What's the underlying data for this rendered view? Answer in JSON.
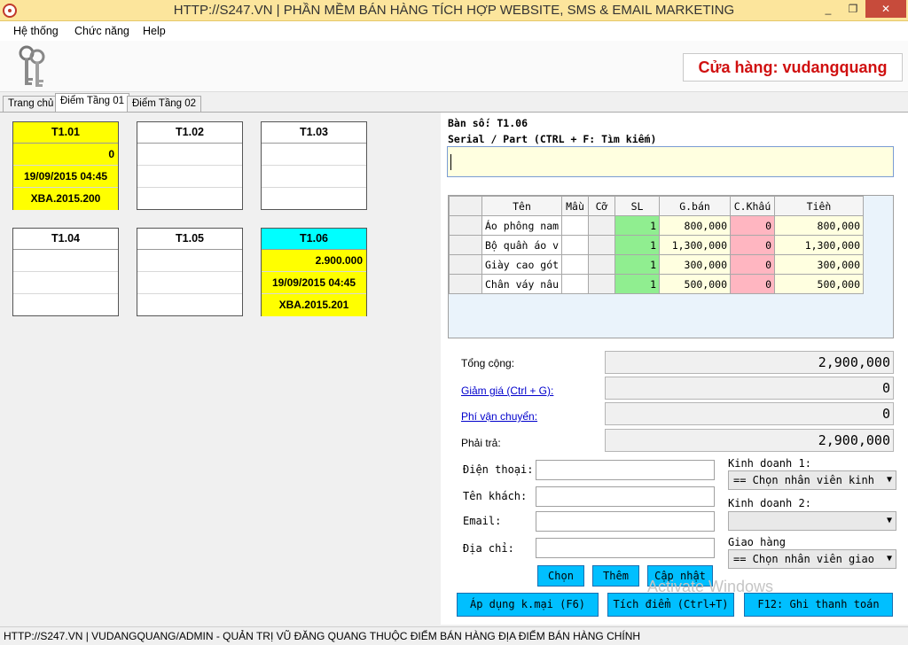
{
  "window": {
    "title": "HTTP://S247.VN | PHẦN MỀM BÁN HÀNG TÍCH HỢP WEBSITE, SMS & EMAIL MARKETING",
    "minimize": "_",
    "restore": "❐",
    "close": "✕"
  },
  "menu": [
    "Hệ thống",
    "Chức năng",
    "Help"
  ],
  "toolbar": {
    "store_label": "Cửa hàng: vudangquang",
    "keys_icon": "keys-icon"
  },
  "tabs": [
    {
      "label": "Trang chủ",
      "active": false
    },
    {
      "label": "Điểm Tầng 01",
      "active": true
    },
    {
      "label": "Điểm Tầng 02",
      "active": false
    }
  ],
  "tables": [
    {
      "name": "T1.01",
      "amount": "0",
      "time": "19/09/2015 04:45",
      "code": "XBA.2015.200"
    },
    {
      "name": "T1.02",
      "amount": "",
      "time": "",
      "code": ""
    },
    {
      "name": "T1.03",
      "amount": "",
      "time": "",
      "code": ""
    },
    {
      "name": "T1.04",
      "amount": "",
      "time": "",
      "code": ""
    },
    {
      "name": "T1.05",
      "amount": "",
      "time": "",
      "code": ""
    },
    {
      "name": "T1.06",
      "amount": "2.900.000",
      "time": "19/09/2015 04:45",
      "code": "XBA.2015.201"
    }
  ],
  "order": {
    "ban_so": "Bàn số: T1.06",
    "serial_label": "Serial / Part (CTRL + F: Tìm kiếm)",
    "serial_value": "",
    "columns": [
      "Tên",
      "Mầu",
      "Cỡ",
      "SL",
      "G.bán",
      "C.Khấu",
      "Tiền"
    ],
    "items": [
      {
        "name": "Áo phông nam",
        "mau": "",
        "co": "",
        "sl": "1",
        "gia": "800,000",
        "ck": "0",
        "tien": "800,000"
      },
      {
        "name": "Bộ quần áo v",
        "mau": "",
        "co": "",
        "sl": "1",
        "gia": "1,300,000",
        "ck": "0",
        "tien": "1,300,000"
      },
      {
        "name": "Giày cao gót",
        "mau": "",
        "co": "",
        "sl": "1",
        "gia": "300,000",
        "ck": "0",
        "tien": "300,000"
      },
      {
        "name": "Chân váy nâu",
        "mau": "",
        "co": "",
        "sl": "1",
        "gia": "500,000",
        "ck": "0",
        "tien": "500,000"
      }
    ]
  },
  "totals": {
    "tong_cong_label": "Tổng cộng:",
    "tong_cong": "2,900,000",
    "giam_gia_label": "Giảm giá (Ctrl + G):",
    "giam_gia": "0",
    "phi_van_chuyen_label": "Phí vận chuyển:",
    "phi_van_chuyen": "0",
    "phai_tra_label": "Phải trả:",
    "phai_tra": "2,900,000"
  },
  "customer": {
    "phone_label": "Điện thoại:",
    "phone": "",
    "name_label": "Tên khách:",
    "name": "",
    "email_label": "Email:",
    "email": "",
    "address_label": "Địa chỉ:",
    "address": "",
    "kd1_label": "Kinh doanh 1:",
    "kd1_value": "== Chọn nhân viên kinh",
    "kd2_label": "Kinh doanh 2:",
    "kd2_value": "",
    "giao_hang_label": "Giao hàng",
    "giao_hang_value": "== Chọn nhân viên giao"
  },
  "buttons": {
    "chon": "Chọn",
    "them": "Thêm",
    "cap_nhat": "Cập nhật",
    "ap_dung": "Áp dụng k.mại (F6)",
    "tich_diem": "Tích điểm (Ctrl+T)",
    "thanh_toan": "F12: Ghi thanh toán"
  },
  "watermark": "Activate Windows",
  "status": "HTTP://S247.VN  | VUDANGQUANG/ADMIN - QUẢN TRỊ VŨ ĐĂNG QUANG THUỘC ĐIỂM BÁN HÀNG ĐỊA ĐIỂM BÁN HÀNG CHÍNH",
  "colors": {
    "title_bar": "#fce59c",
    "busy_table": "#ffff00",
    "selected_table": "#00ffff",
    "button": "#00bfff",
    "store_text": "#d01010"
  }
}
